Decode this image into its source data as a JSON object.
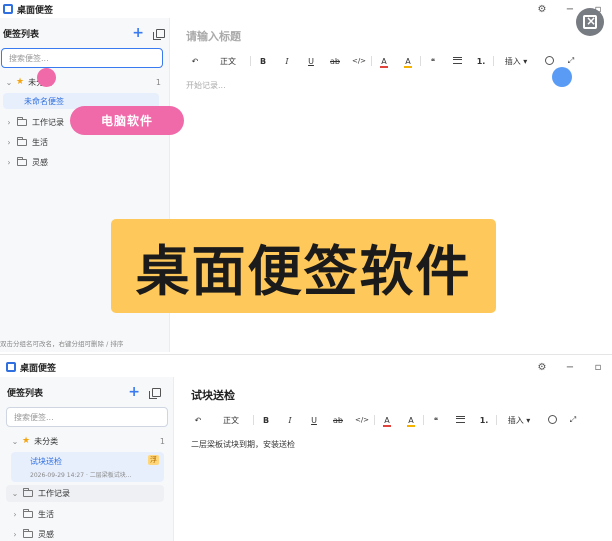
{
  "app": {
    "title": "桌面便签"
  },
  "window_controls": {
    "settings": "⚙",
    "minimize": "−",
    "maximize": "▫",
    "close": "×"
  },
  "top": {
    "sidebar": {
      "title": "便签列表",
      "search_placeholder": "搜索便签...",
      "tree": [
        {
          "label": "未分类",
          "count": "1"
        },
        {
          "label": "未命名便签"
        },
        {
          "label": "工作记录"
        },
        {
          "label": "生活"
        },
        {
          "label": "灵感"
        }
      ],
      "footer": "双击分组名可改名，右键分组可删除 / 排序"
    },
    "editor": {
      "title_placeholder": "请输入标题",
      "body_placeholder": "开始记录..."
    }
  },
  "bottom": {
    "sidebar": {
      "title": "便签列表",
      "search_placeholder": "搜索便签...",
      "tree": [
        {
          "label": "未分类",
          "count": "1"
        },
        {
          "label": "试块送检",
          "meta": "2026-09-29 14:27 · 二层梁板试块...",
          "badge": "浮"
        },
        {
          "label": "工作记录"
        },
        {
          "label": "生活"
        },
        {
          "label": "灵感"
        }
      ]
    },
    "editor": {
      "title": "试块送检",
      "body": "二层梁板试块到期，安装送检"
    }
  },
  "toolbar": {
    "undo": "↶",
    "paragraph": "正文",
    "bold": "B",
    "italic": "I",
    "underline": "U",
    "strike": "ab",
    "code": "</>",
    "font_color": "A",
    "highlight": "A",
    "quote": "❝",
    "ordered": "1.",
    "insert": "插入 ▾",
    "expand": "⤢"
  },
  "overlay": {
    "pill": "电脑软件",
    "banner": "桌面便签软件"
  },
  "colors": {
    "accent": "#3a7af0",
    "pink": "#f06aa9",
    "banner": "#ffc85a",
    "star": "#f1a512"
  }
}
